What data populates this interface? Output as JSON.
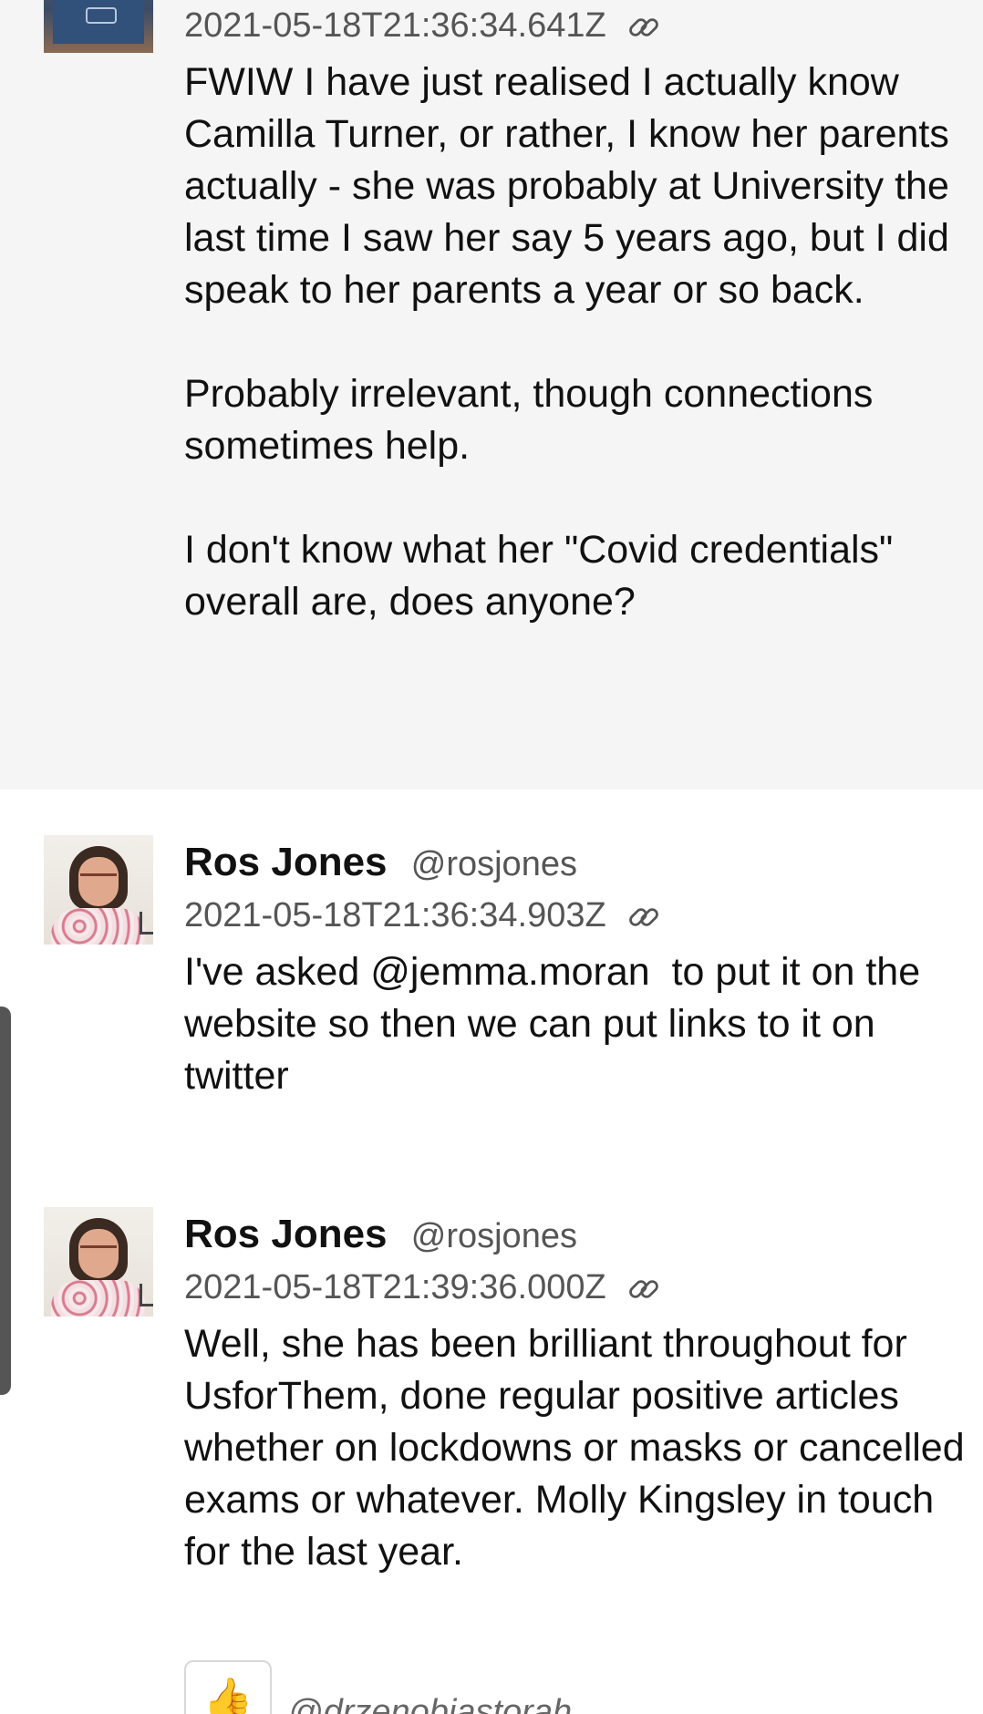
{
  "messages": [
    {
      "author": "",
      "handle": "",
      "timestamp": "2021-05-18T21:36:34.641Z",
      "body": "FWIW I have just realised I actually know Camilla Turner, or rather, I know her parents actually - she was probably at University the last time I saw her say 5 years ago, but I did speak to her parents a year or so back.\n\nProbably irrelevant, though connections sometimes help.\n\nI don't know what her \"Covid credentials\" overall are, does anyone?"
    },
    {
      "author": "Ros Jones",
      "handle": "@rosjones",
      "timestamp": "2021-05-18T21:36:34.903Z",
      "body": "I've asked @jemma.moran  to put it on the website so then we can put links to it on twitter"
    },
    {
      "author": "Ros Jones",
      "handle": "@rosjones",
      "timestamp": "2021-05-18T21:39:36.000Z",
      "body": "Well, she has been brilliant throughout for UsforThem, done regular positive articles whether on lockdowns or masks or cancelled exams or whatever. Molly Kingsley in touch for the last year."
    }
  ],
  "reaction": {
    "emoji": "👍",
    "user": "@drzenobiastorah"
  },
  "icons": {
    "permalink": "link-icon",
    "reaction": "thumbs-up-icon"
  },
  "colors": {
    "first_message_bg": "#f5f5f5",
    "text": "#111111",
    "muted": "#555555"
  }
}
